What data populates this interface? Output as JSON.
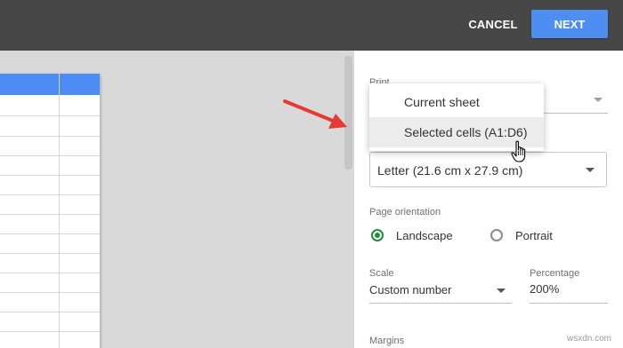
{
  "header": {
    "cancel_label": "CANCEL",
    "next_label": "NEXT"
  },
  "panel": {
    "print_label": "Print",
    "print_options": [
      "Current sheet",
      "Selected cells (A1:D6)"
    ],
    "paper_size_value": "Letter (21.6 cm x 27.9 cm)",
    "orientation_label": "Page orientation",
    "orientation_options": [
      "Landscape",
      "Portrait"
    ],
    "orientation_selected": "Landscape",
    "scale_label": "Scale",
    "scale_value": "Custom number",
    "percentage_label": "Percentage",
    "percentage_value": "200%",
    "margins_label": "Margins"
  },
  "watermark": "wsxdn.com",
  "colors": {
    "topbar": "#474747",
    "next_button": "#4d8ef0",
    "sheet_header": "#4c8df5",
    "radio_selected": "#1e8e3e",
    "annotation_arrow": "#e53935"
  }
}
